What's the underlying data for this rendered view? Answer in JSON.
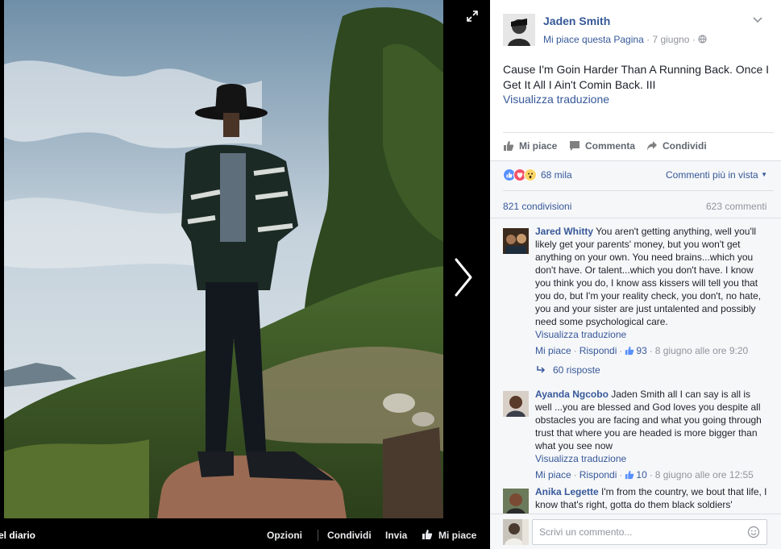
{
  "viewer": {
    "bottom_bar": {
      "diario": "el diario",
      "options": "Opzioni",
      "share": "Condividi",
      "send": "Invia",
      "like": "Mi piace"
    }
  },
  "post": {
    "author": "Jaden Smith",
    "page_like": "Mi piace questa Pagina",
    "date": "7 giugno",
    "text": "Cause I'm Goin Harder Than A Running Back. Once I Get It All I Ain't Comin Back. III",
    "translate": "Visualizza traduzione",
    "actions": {
      "like": "Mi piace",
      "comment": "Commenta",
      "share": "Condividi"
    },
    "reactions_count": "68 mila",
    "sort_label": "Commenti più in vista",
    "shares": "821 condivisioni",
    "comments_total": "623 commenti"
  },
  "comments": [
    {
      "author": "Jared Whitty",
      "text": "You aren't getting anything, well you'll likely get your parents' money, but you won't get anything on your own. You need brains...which you don't have. Or talent...which you don't have. I know you think you do, I know ass kissers will tell you that you do, but I'm your reality check, you don't, no hate, you and your sister are just untalented and possibly need some psychological care.",
      "translate": "Visualizza traduzione",
      "like": "Mi piace",
      "reply": "Rispondi",
      "likes": "93",
      "time": "8 giugno alle ore 9:20"
    },
    {
      "author": "Ayanda Ngcobo",
      "text": "Jaden Smith all I can say is all is well ...you are blessed and God loves you despite all obstacles you are facing and what you going through trust that where you are headed is more bigger than what you see now",
      "translate": "Visualizza traduzione",
      "like": "Mi piace",
      "reply": "Rispondi",
      "likes": "10",
      "time": "8 giugno alle ore 12:55"
    },
    {
      "author": "Anika Legette",
      "text": "I'm from the country, we bout that life, I know that's right, gotta do them black soldiers'"
    }
  ],
  "replies_label": "60 risposte",
  "composer": {
    "placeholder": "Scrivi un commento..."
  },
  "colors": {
    "link": "#365899",
    "muted": "#90949c",
    "like_blue": "#5890ff",
    "love_red": "#f25268",
    "wow_yellow": "#fcd669"
  }
}
